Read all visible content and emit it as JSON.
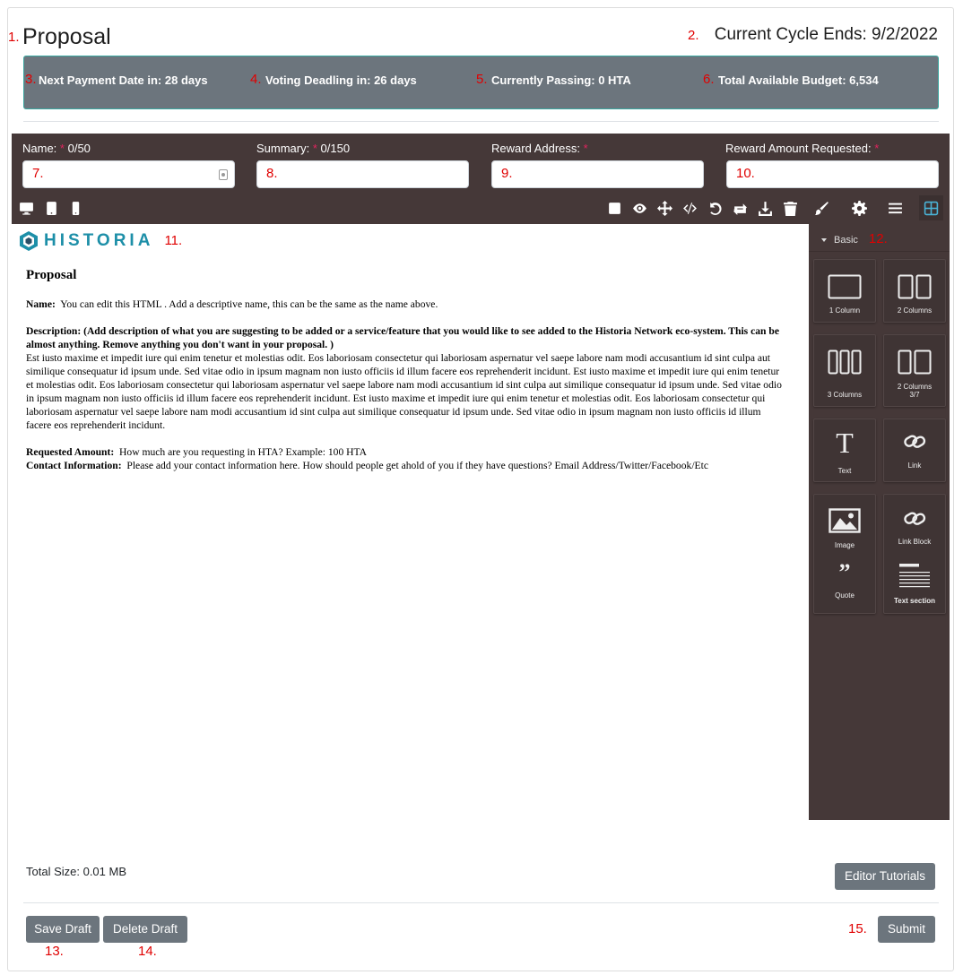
{
  "header": {
    "title": "Proposal",
    "cycle": "Current Cycle Ends: 9/2/2022"
  },
  "stats": {
    "payment": "Next Payment Date in: 28 days",
    "voting": "Voting Deadling in: 26 days",
    "passing": "Currently Passing: 0 HTA",
    "budget": "Total Available Budget: 6,534"
  },
  "fields": {
    "name_label": "Name:",
    "name_count": "0/50",
    "summary_label": "Summary:",
    "summary_count": "0/150",
    "address_label": "Reward Address:",
    "amount_label": "Reward Amount Requested:",
    "required_mark": "*"
  },
  "toolbar": {
    "left_icons": [
      "desktop-icon",
      "tablet-icon",
      "mobile-icon"
    ],
    "right_icons": [
      "square-icon",
      "eye-icon",
      "move-icon",
      "code-icon",
      "undo-icon",
      "redo-icon",
      "download-icon",
      "trash-icon",
      "brush-icon",
      "gear-icon",
      "menu-icon",
      "blocks-icon"
    ]
  },
  "canvas": {
    "logo_text": "HISTORIA",
    "heading": "Proposal",
    "name_bold": "Name:",
    "name_text": "You can edit this HTML . Add a descriptive name, this can be the same as the name above.",
    "desc_bold": "Description: (Add description of what you are suggesting to be added or a service/feature that you would like to see added to the Historia Network eco-system. This can be almost anything.  Remove anything you don't want in your proposal. )",
    "desc_text": "Est iusto maxime et impedit iure qui enim tenetur et molestias odit. Eos laboriosam consectetur qui laboriosam aspernatur vel saepe labore nam modi accusantium id sint culpa aut similique consequatur id ipsum unde. Sed vitae odio in ipsum magnam non iusto officiis id illum facere eos reprehenderit incidunt. Est iusto maxime et impedit iure qui enim tenetur et molestias odit. Eos laboriosam consectetur qui laboriosam aspernatur vel saepe labore nam modi accusantium id sint culpa aut similique consequatur id ipsum unde. Sed vitae odio in ipsum magnam non iusto officiis id illum facere eos reprehenderit incidunt. Est iusto maxime et impedit iure qui enim tenetur et molestias odit. Eos laboriosam consectetur qui laboriosam aspernatur vel saepe labore nam modi accusantium id sint culpa aut similique consequatur id ipsum unde. Sed vitae odio in ipsum magnam non iusto officiis id illum facere eos reprehenderit incidunt.",
    "amount_bold": "Requested Amount:",
    "amount_text": "How much are you requesting in HTA? Example: 100 HTA",
    "contact_bold": "Contact Information:",
    "contact_text": "Please add your contact information here. How should people get ahold of you if they have questions? Email Address/Twitter/Facebook/Etc"
  },
  "blocks": {
    "category": "Basic",
    "items": [
      "1 Column",
      "2 Columns",
      "3 Columns",
      "2 Columns 3/7",
      "Text",
      "Link",
      "Image",
      "Link Block",
      "Quote",
      "Text section"
    ]
  },
  "footer": {
    "total_size": "Total Size: 0.01 MB",
    "tutorials": "Editor Tutorials",
    "save": "Save Draft",
    "delete": "Delete Draft",
    "submit": "Submit"
  },
  "annotations": [
    "1.",
    "2.",
    "3.",
    "4.",
    "5.",
    "6.",
    "7.",
    "8.",
    "9.",
    "10.",
    "11.",
    "12.",
    "13.",
    "14.",
    "15."
  ],
  "colors": {
    "dark_panel": "#453838",
    "stats_bg": "#6c757d",
    "stats_border": "#3aa7a0",
    "button": "#6c757d",
    "annotation": "#e00000",
    "logo": "#1d8fa8"
  }
}
